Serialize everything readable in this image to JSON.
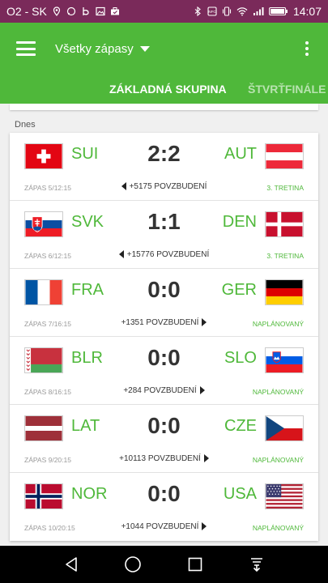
{
  "statusbar": {
    "carrier": "O2 - SK",
    "time": "14:07",
    "icons": [
      "location-icon",
      "chat-icon",
      "beat-icon",
      "image-icon",
      "briefcase-icon",
      "bluetooth-icon",
      "nfc-icon",
      "vibrate-icon",
      "wifi-icon",
      "signal-icon",
      "battery-icon"
    ]
  },
  "appbar": {
    "title": "Všetky zápasy",
    "menu_icon": "hamburger-icon",
    "overflow_icon": "overflow-menu-icon"
  },
  "tabs": [
    {
      "label": "ZÁKLADNÁ SKUPINA",
      "active": true
    },
    {
      "label": "ŠTVRŤFINÁLE",
      "active": false
    }
  ],
  "section_label": "Dnes",
  "matches": [
    {
      "home": "SUI",
      "away": "AUT",
      "score": "2:2",
      "info": "ZÁPAS 5/12:15",
      "cheer": "+5175 POVZBUDENÍ",
      "cheer_side": "left",
      "status": "3. TRETINA"
    },
    {
      "home": "SVK",
      "away": "DEN",
      "score": "1:1",
      "info": "ZÁPAS 6/12:15",
      "cheer": "+15776 POVZBUDENÍ",
      "cheer_side": "left",
      "status": "3. TRETINA"
    },
    {
      "home": "FRA",
      "away": "GER",
      "score": "0:0",
      "info": "ZÁPAS 7/16:15",
      "cheer": "+1351 POVZBUDENÍ",
      "cheer_side": "right",
      "status": "NAPLÁNOVANÝ"
    },
    {
      "home": "BLR",
      "away": "SLO",
      "score": "0:0",
      "info": "ZÁPAS 8/16:15",
      "cheer": "+284 POVZBUDENÍ",
      "cheer_side": "right",
      "status": "NAPLÁNOVANÝ"
    },
    {
      "home": "LAT",
      "away": "CZE",
      "score": "0:0",
      "info": "ZÁPAS 9/20:15",
      "cheer": "+10113 POVZBUDENÍ",
      "cheer_side": "right",
      "status": "NAPLÁNOVANÝ"
    },
    {
      "home": "NOR",
      "away": "USA",
      "score": "0:0",
      "info": "ZÁPAS 10/20:15",
      "cheer": "+1044 POVZBUDENÍ",
      "cheer_side": "right",
      "status": "NAPLÁNOVANÝ"
    }
  ],
  "colors": {
    "primary": "#4fb83a",
    "statusbar": "#7a2a5a",
    "score_text": "#333333",
    "meta_text": "#9a9a9a"
  },
  "navbar": {
    "icons": [
      "back-icon",
      "home-icon",
      "recents-icon",
      "notifications-down-icon"
    ]
  }
}
